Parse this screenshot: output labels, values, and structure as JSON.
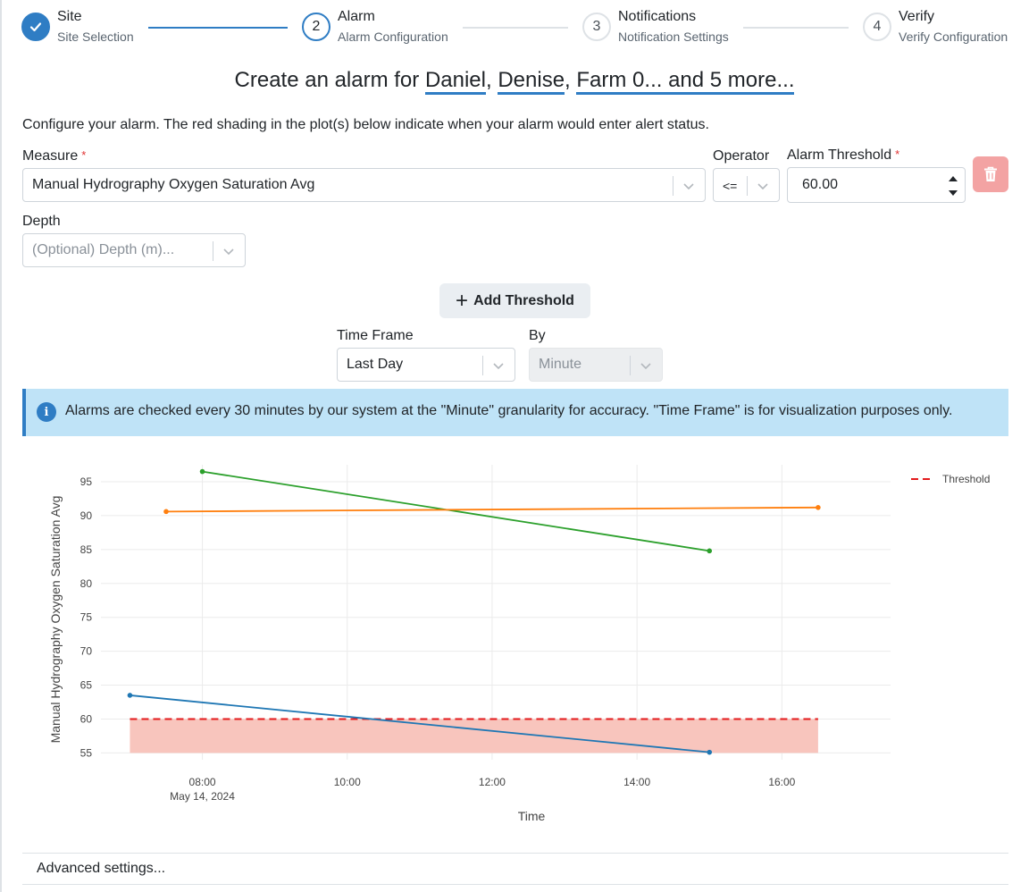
{
  "stepper": {
    "steps": [
      {
        "number": "1",
        "title": "Site",
        "subtitle": "Site Selection",
        "state": "done"
      },
      {
        "number": "2",
        "title": "Alarm",
        "subtitle": "Alarm Configuration",
        "state": "active"
      },
      {
        "number": "3",
        "title": "Notifications",
        "subtitle": "Notification Settings",
        "state": "pending"
      },
      {
        "number": "4",
        "title": "Verify",
        "subtitle": "Verify Configuration",
        "state": "pending"
      }
    ]
  },
  "header": {
    "title_prefix": "Create an alarm for ",
    "site_1": "Daniel",
    "site_2": "Denise",
    "site_more": "Farm 0... and 5 more...",
    "separator": ", "
  },
  "intro_text": "Configure your alarm. The red shading in the plot(s) below indicate when your alarm would enter alert status.",
  "form": {
    "measure_label": "Measure",
    "measure_value": "Manual Hydrography Oxygen Saturation Avg",
    "operator_label": "Operator",
    "operator_value": "<=",
    "threshold_label": "Alarm Threshold",
    "threshold_value": "60.00",
    "required_mark": "*",
    "depth_label": "Depth",
    "depth_placeholder": "(Optional) Depth (m)...",
    "add_threshold_label": "Add Threshold",
    "timeframe_label": "Time Frame",
    "timeframe_value": "Last Day",
    "by_label": "By",
    "by_value": "Minute"
  },
  "info": {
    "icon": "info-icon",
    "text": "Alarms are checked every 30 minutes by our system at the \"Minute\" granularity for accuracy. \"Time Frame\" is for visualization purposes only."
  },
  "chart_data": {
    "type": "line",
    "title": "",
    "xlabel": "Time",
    "ylabel": "Manual Hydrography Oxygen Saturation Avg",
    "x_unit": "hour of day, May 14, 2024",
    "xlim": [
      6.6,
      17.5
    ],
    "ylim": [
      54,
      97.5
    ],
    "grid": true,
    "legend_position": "top-right",
    "x_ticks": [
      {
        "value": 8,
        "label": "08:00",
        "sublabel": "May 14, 2024"
      },
      {
        "value": 10,
        "label": "10:00",
        "sublabel": ""
      },
      {
        "value": 12,
        "label": "12:00",
        "sublabel": ""
      },
      {
        "value": 14,
        "label": "14:00",
        "sublabel": ""
      },
      {
        "value": 16,
        "label": "16:00",
        "sublabel": ""
      }
    ],
    "y_ticks": [
      55,
      60,
      65,
      70,
      75,
      80,
      85,
      90,
      95
    ],
    "series": [
      {
        "color": "#2ca02c",
        "points": [
          [
            8.0,
            96.5
          ],
          [
            15.0,
            84.8
          ]
        ]
      },
      {
        "color": "#ff7f0e",
        "points": [
          [
            7.5,
            90.6
          ],
          [
            16.5,
            91.2
          ]
        ]
      },
      {
        "color": "#1f77b4",
        "points": [
          [
            7.0,
            63.5
          ],
          [
            15.0,
            55.1
          ]
        ]
      }
    ],
    "threshold": {
      "name": "Threshold",
      "value": 60,
      "color": "#e31a1c",
      "x_range": [
        7.0,
        16.5
      ],
      "shade_to": 55,
      "shade_color": "#f8c5bd"
    }
  },
  "advanced": {
    "label": "Advanced settings..."
  }
}
